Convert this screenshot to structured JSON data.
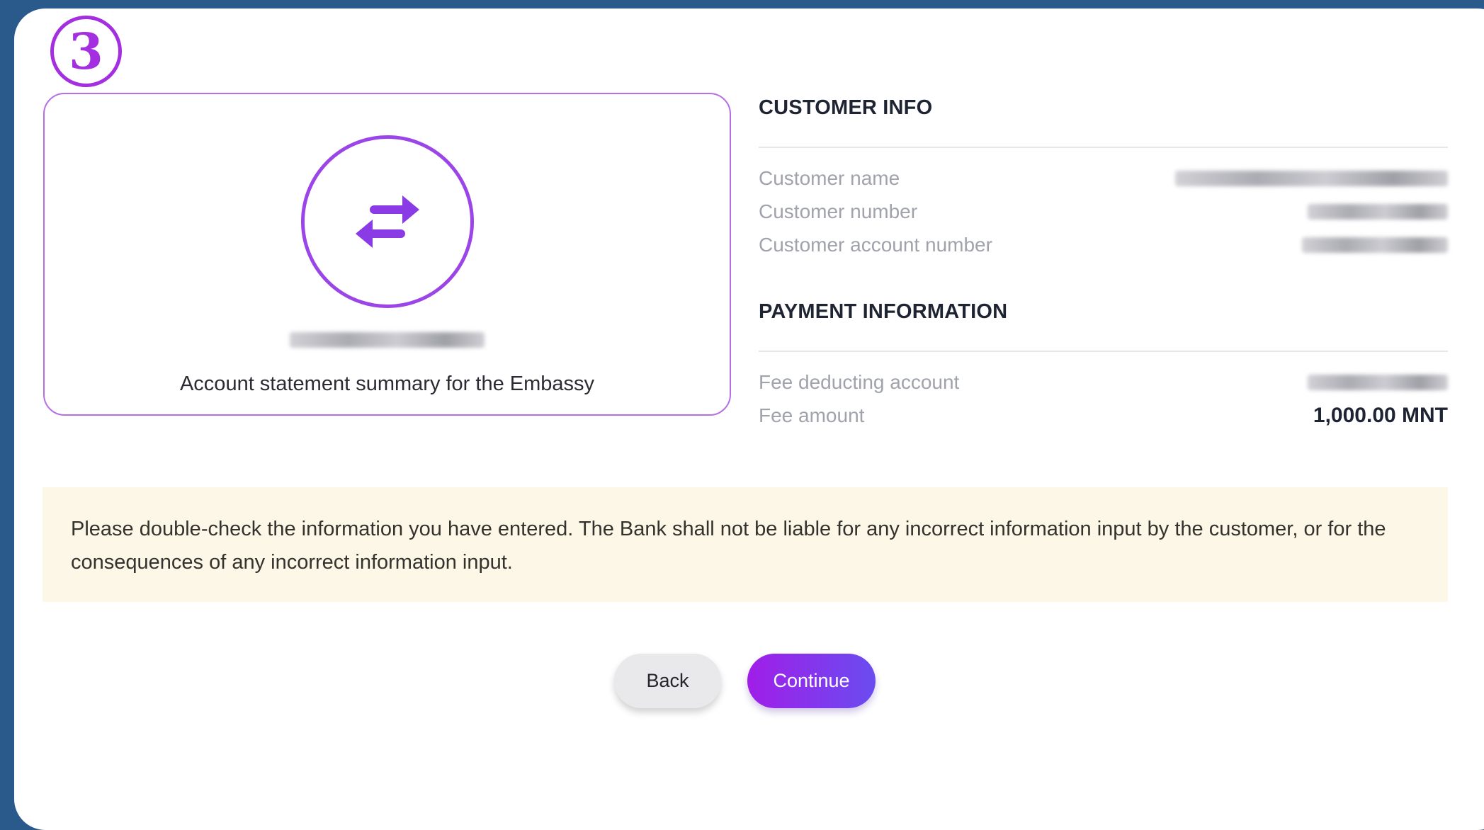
{
  "step": {
    "number": "3"
  },
  "summary": {
    "icon": "transfer-arrows-icon",
    "amount_redacted": true,
    "caption": "Account statement summary for the Embassy"
  },
  "customer_info": {
    "title": "CUSTOMER INFO",
    "rows": [
      {
        "label": "Customer name"
      },
      {
        "label": "Customer number"
      },
      {
        "label": "Customer account number"
      }
    ]
  },
  "payment_info": {
    "title": "PAYMENT INFORMATION",
    "fee_account_label": "Fee deducting account",
    "fee_amount_label": "Fee amount",
    "fee_amount_value": "1,000.00 MNT"
  },
  "notice": {
    "text": "Please double-check the information you have entered. The Bank shall not be liable for any incorrect information input by the customer, or for the consequences of any incorrect information input."
  },
  "actions": {
    "back_label": "Back",
    "continue_label": "Continue"
  },
  "colors": {
    "accent": "#a42fe0",
    "button_gradient_start": "#a01ee8",
    "button_gradient_end": "#6a4cf0",
    "notice_bg": "#fdf7e8",
    "frame_bg": "#2a5a8c"
  }
}
